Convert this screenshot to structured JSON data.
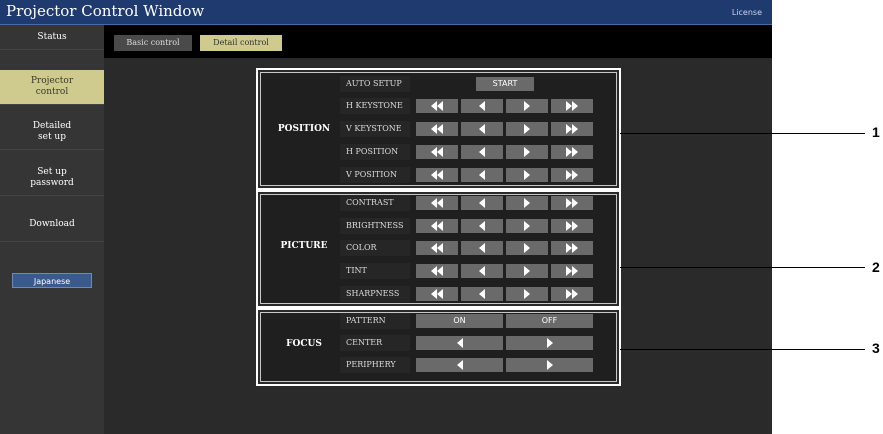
{
  "window": {
    "title": "Projector Control Window",
    "license_link": "License"
  },
  "sidebar": {
    "items": [
      {
        "label": "Status"
      },
      {
        "label": "Projector\ncontrol",
        "active": true
      },
      {
        "label": "Detailed\nset up"
      },
      {
        "label": "Set up\npassword"
      },
      {
        "label": "Download"
      }
    ],
    "language_button": "Japanese"
  },
  "tabs": [
    {
      "label": "Basic control",
      "active": false
    },
    {
      "label": "Detail control",
      "active": true
    }
  ],
  "groups": {
    "position": {
      "label": "POSITION",
      "rows": [
        {
          "label": "AUTO SETUP",
          "button": "START"
        },
        {
          "label": "H KEYSTONE"
        },
        {
          "label": "V KEYSTONE"
        },
        {
          "label": "H POSITION"
        },
        {
          "label": "V POSITION"
        }
      ]
    },
    "picture": {
      "label": "PICTURE",
      "rows": [
        {
          "label": "CONTRAST"
        },
        {
          "label": "BRIGHTNESS"
        },
        {
          "label": "COLOR"
        },
        {
          "label": "TINT"
        },
        {
          "label": "SHARPNESS"
        }
      ]
    },
    "focus": {
      "label": "FOCUS",
      "rows": [
        {
          "label": "PATTERN",
          "on": "ON",
          "off": "OFF"
        },
        {
          "label": "CENTER"
        },
        {
          "label": "PERIPHERY"
        }
      ]
    }
  },
  "callouts": [
    "1",
    "2",
    "3"
  ],
  "icons": {
    "fast_left": "double-left-arrow-icon",
    "left": "left-arrow-icon",
    "right": "right-arrow-icon",
    "fast_right": "double-right-arrow-icon"
  },
  "colors": {
    "titlebar": "#1e3a6e",
    "active_nav": "#cfcb8e",
    "button": "#6a6a6a",
    "lang_button": "#3a5a8c"
  }
}
